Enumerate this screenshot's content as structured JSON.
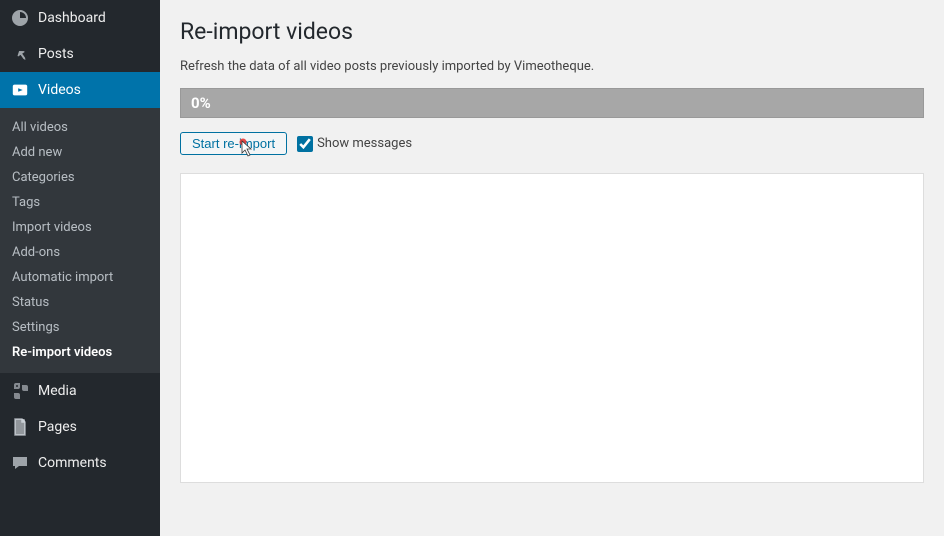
{
  "sidebar": {
    "dashboard": "Dashboard",
    "posts": "Posts",
    "videos": "Videos",
    "media": "Media",
    "pages": "Pages",
    "comments": "Comments",
    "submenu": [
      "All videos",
      "Add new",
      "Categories",
      "Tags",
      "Import videos",
      "Add-ons",
      "Automatic import",
      "Status",
      "Settings",
      "Re-import videos"
    ]
  },
  "main": {
    "title": "Re-import videos",
    "description": "Refresh the data of all video posts previously imported by Vimeotheque.",
    "progress": "0%",
    "start_button": "Start re-import",
    "show_messages_label": "Show messages",
    "show_messages_checked": true,
    "log": ""
  }
}
